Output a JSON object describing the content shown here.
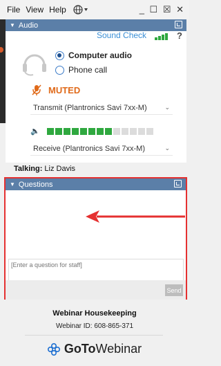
{
  "menu": {
    "items": [
      "File",
      "View",
      "Help"
    ],
    "globe_icon": "globe-icon",
    "window_controls": "_ ☐ ☒ ✕"
  },
  "audio_panel": {
    "title": "Audio",
    "sound_check": "Sound Check",
    "help": "?",
    "mode_options": [
      {
        "label": "Computer audio",
        "selected": true
      },
      {
        "label": "Phone call",
        "selected": false
      }
    ],
    "mute_status": "MUTED",
    "transmit_device": "Transmit (Plantronics Savi 7xx-M)",
    "receive_device": "Receive (Plantronics Savi 7xx-M)",
    "speaker_level_fraction": 0.62,
    "speaker_level_segments": 13,
    "colors": {
      "accent": "#3a8fd6",
      "muted": "#e06a1a",
      "level_on": "#2fa83f",
      "level_off": "#dcdcdc"
    }
  },
  "talking": {
    "label": "Talking:",
    "name": "Liz Davis"
  },
  "questions_panel": {
    "title": "Questions",
    "input_placeholder": "[Enter a question for staff]",
    "send_label": "Send",
    "highlight_color": "#e53030"
  },
  "footer": {
    "title": "Webinar Housekeeping",
    "webinar_id": "Webinar ID: 608-865-371",
    "brand_go": "GoTo",
    "brand_webinar": "Webinar"
  }
}
